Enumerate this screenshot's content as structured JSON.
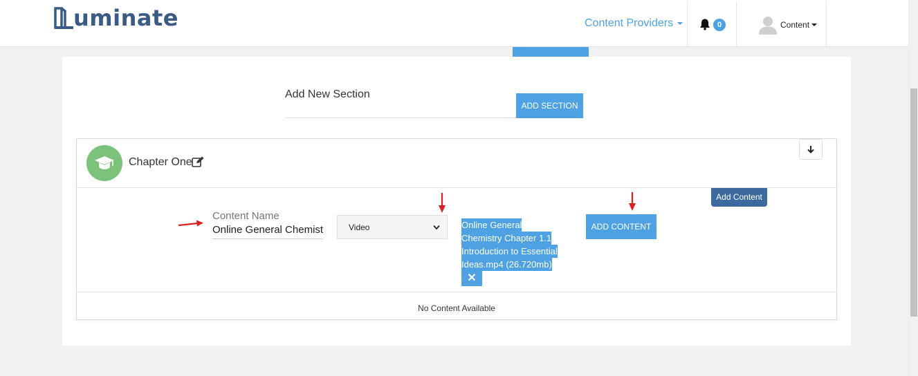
{
  "brand": {
    "name": "uminate",
    "color": "#3b5b86"
  },
  "nav": {
    "content_providers": "Content Providers",
    "notification_count": "0",
    "user_label": "Content"
  },
  "section": {
    "label": "Add New Section",
    "add_button": "ADD SECTION"
  },
  "chapter": {
    "title": "Chapter One",
    "add_content_tooltip": "Add Content",
    "content_name_label": "Content Name",
    "content_name_value": "Online General Chemist",
    "content_type_selected": "Video",
    "uploaded_file_lines": [
      " Online General",
      "Chemistry Chapter 1.1",
      "Introduction to Essential",
      "Ideas.mp4 (26.720mb)"
    ],
    "remove_symbol": "✕",
    "add_content_button": "ADD CONTENT",
    "empty_message": "No Content Available"
  },
  "colors": {
    "accent": "#4ea2e4",
    "chapter_icon_bg": "#7dc27b",
    "tooltip_bg": "#3d6a9e",
    "annotation_arrow": "#e02020"
  }
}
